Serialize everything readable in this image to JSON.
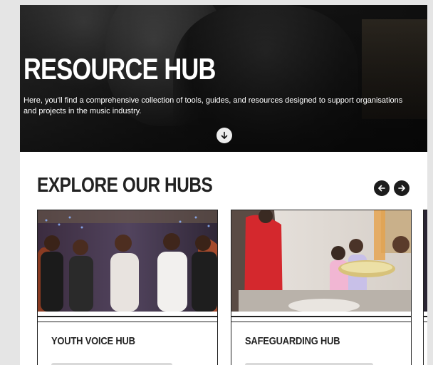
{
  "hero": {
    "title": "RESOURCE HUB",
    "description": "Here, you'll find a comprehensive collection of tools, guides, and resources designed to support organisations and projects in the music industry.",
    "scroll_icon": "arrow-down-icon"
  },
  "explore": {
    "title": "EXPLORE OUR HUBS",
    "prev_icon": "arrow-left-icon",
    "next_icon": "arrow-right-icon"
  },
  "cards": [
    {
      "title": "YOUTH VOICE HUB",
      "image": "choir-singers-photo"
    },
    {
      "title": "SAFEGUARDING HUB",
      "image": "children-drum-workshop-photo"
    },
    {
      "title": "",
      "image": "partial-card-photo"
    }
  ],
  "colors": {
    "page_background": "#e5e5e5",
    "hero_text": "#ffffff",
    "heading_text": "#222222",
    "nav_button": "#1c1c1c"
  }
}
